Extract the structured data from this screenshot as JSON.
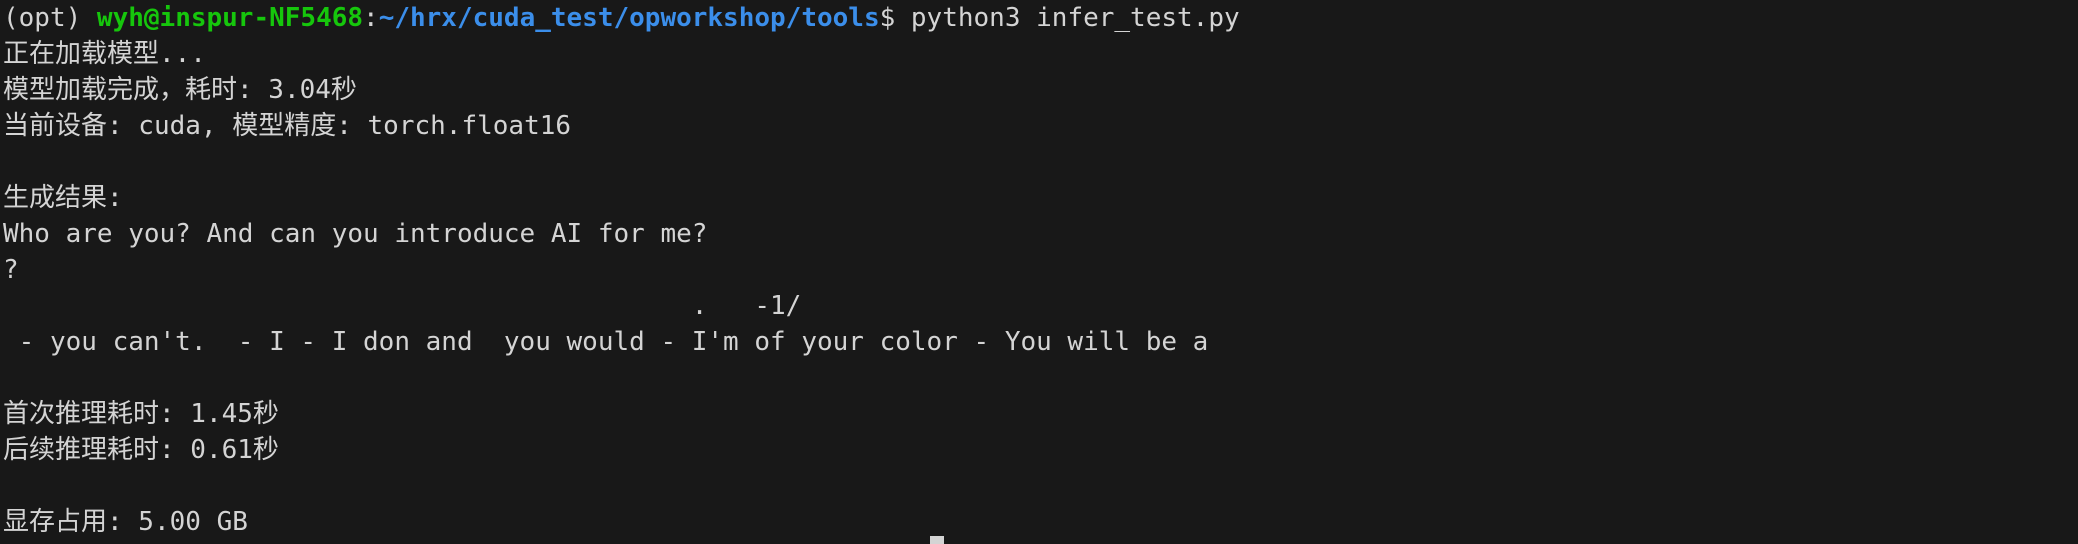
{
  "prompt": {
    "env": "(opt) ",
    "user_host": "wyh@inspur-NF5468",
    "separator": ":",
    "path": "~/hrx/cuda_test/opworkshop/tools",
    "symbol": "$ ",
    "command": "python3 infer_test.py"
  },
  "output": [
    "正在加载模型...",
    "模型加载完成，耗时: 3.04秒",
    "当前设备: cuda, 模型精度: torch.float16",
    "",
    "生成结果:",
    "Who are you? And can you introduce AI for me?",
    "?",
    "                                            .   -1/",
    " - you can't.  - I - I don and  you would - I'm of your color - You will be a",
    "",
    "首次推理耗时: 1.45秒",
    "后续推理耗时: 0.61秒",
    "",
    "显存占用: 5.00 GB"
  ],
  "colors": {
    "background": "#181818",
    "text": "#d4d4d4",
    "user_host": "#16c60c",
    "path": "#3b8eea"
  }
}
